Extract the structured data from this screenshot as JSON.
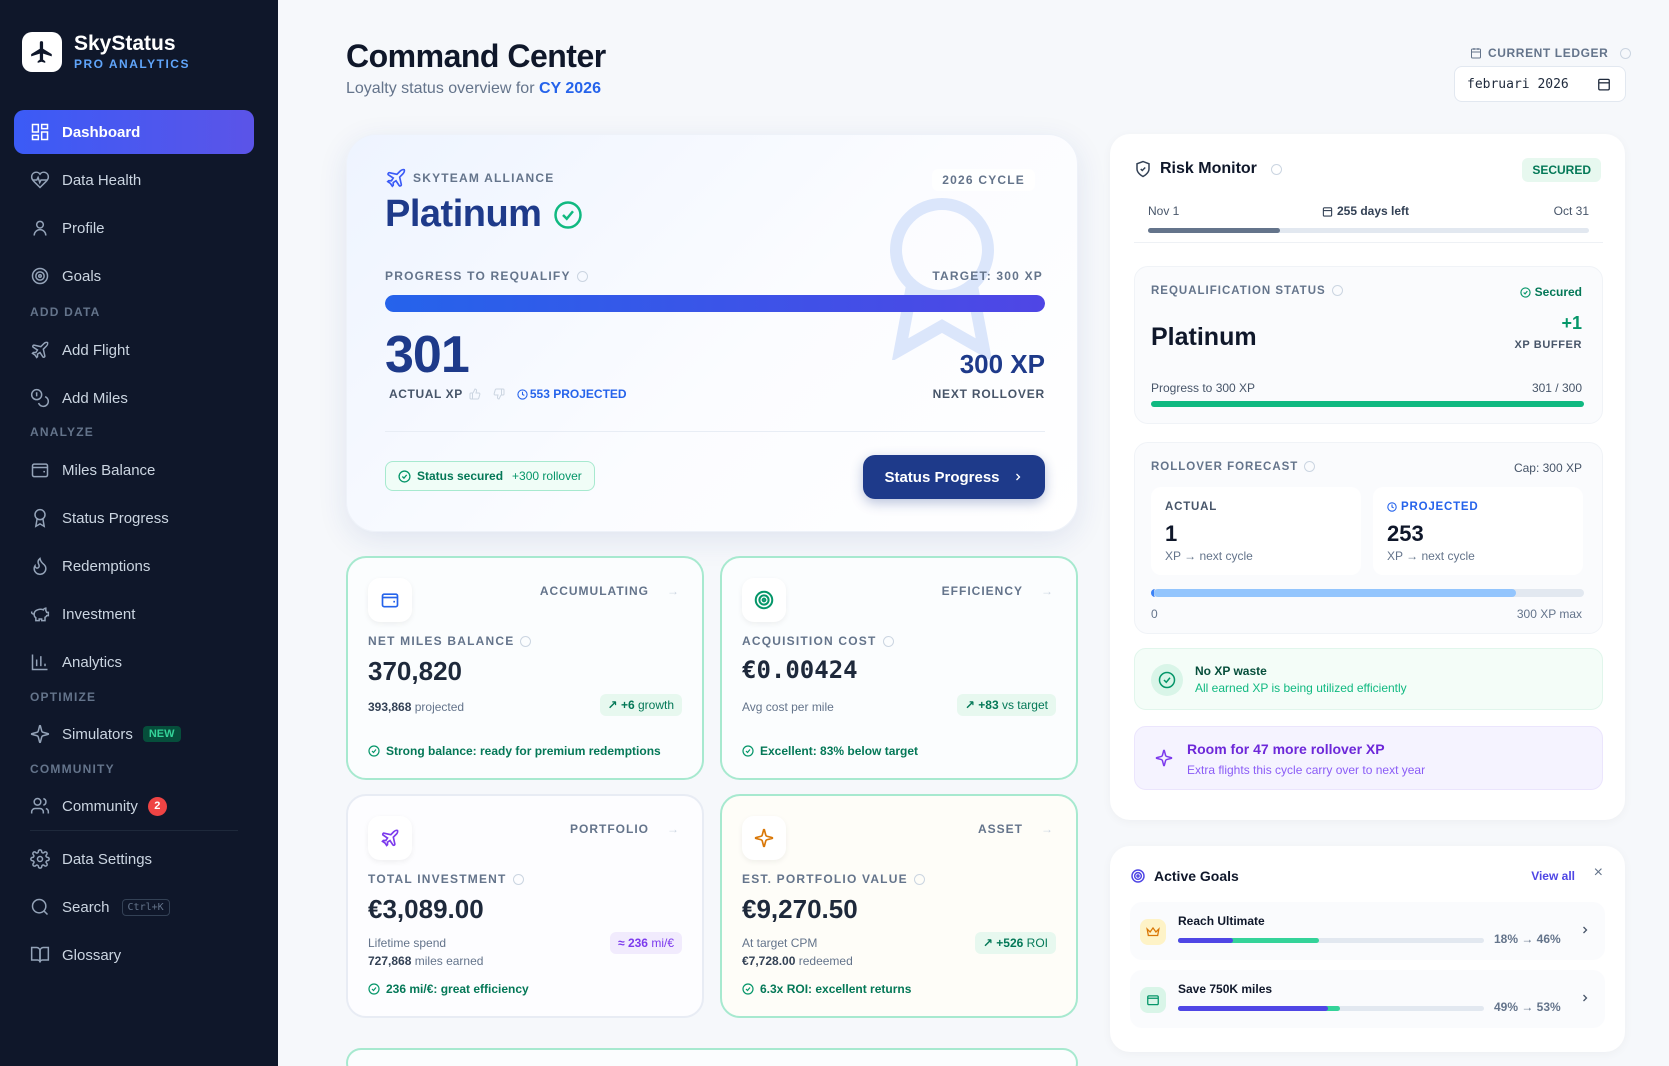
{
  "app": {
    "name": "SkyStatus",
    "subtitle": "PRO ANALYTICS"
  },
  "sidebar": {
    "items": [
      {
        "label": "Dashboard",
        "icon": "grid-icon",
        "active": true
      },
      {
        "label": "Data Health",
        "icon": "heart-pulse-icon"
      },
      {
        "label": "Profile",
        "icon": "user-icon"
      },
      {
        "label": "Goals",
        "icon": "target-icon"
      },
      {
        "label": "Add Flight",
        "icon": "plane-icon"
      },
      {
        "label": "Add Miles",
        "icon": "coins-icon"
      },
      {
        "label": "Miles Balance",
        "icon": "wallet-icon"
      },
      {
        "label": "Status Progress",
        "icon": "award-icon"
      },
      {
        "label": "Redemptions",
        "icon": "flame-icon"
      },
      {
        "label": "Investment",
        "icon": "piggy-bank-icon"
      },
      {
        "label": "Analytics",
        "icon": "bar-chart-icon"
      },
      {
        "label": "Simulators",
        "icon": "sparkles-icon",
        "badge": "NEW"
      },
      {
        "label": "Community",
        "icon": "users-icon",
        "count": "2"
      },
      {
        "label": "Data Settings",
        "icon": "gear-icon"
      },
      {
        "label": "Search",
        "icon": "search-icon",
        "shortcut": "Ctrl+K"
      },
      {
        "label": "Glossary",
        "icon": "book-icon"
      }
    ],
    "sections": [
      "ADD DATA",
      "ANALYZE",
      "OPTIMIZE",
      "COMMUNITY"
    ]
  },
  "header": {
    "title": "Command Center",
    "subtitle_prefix": "Loyalty status overview for",
    "subtitle_year": "CY 2026",
    "ledger_label": "CURRENT LEDGER",
    "ledger_value": "februari 2026"
  },
  "hero": {
    "alliance": "SKYTEAM ALLIANCE",
    "status": "Platinum",
    "cycle": "2026 CYCLE",
    "progress_label": "PROGRESS TO REQUALIFY",
    "target": "TARGET: 300 XP",
    "progress_fraction": 1.0,
    "actual_xp": "301",
    "actual_label": "ACTUAL XP",
    "projected": "553 PROJECTED",
    "rollover_value": "300 XP",
    "rollover_label": "NEXT ROLLOVER",
    "secured_text": "Status secured",
    "secured_extra": "+300 rollover",
    "button": "Status Progress"
  },
  "minis": [
    {
      "tag": "ACCUMULATING",
      "label": "NET MILES BALANCE",
      "value": "370,820",
      "sub_value": "393,868",
      "sub_text": "projected",
      "pill_value": "+6",
      "pill_text": "growth",
      "foot": "Strong balance: ready for premium redemptions",
      "icon": "wallet-icon"
    },
    {
      "tag": "EFFICIENCY",
      "label": "ACQUISITION COST",
      "value": "€0.00424",
      "sub_text": "Avg cost per mile",
      "pill_value": "+83",
      "pill_text": "vs target",
      "foot": "Excellent: 83% below target",
      "icon": "target-icon"
    },
    {
      "tag": "PORTFOLIO",
      "label": "TOTAL INVESTMENT",
      "value": "€3,089.00",
      "sub_line1": "Lifetime spend",
      "sub_value": "727,868",
      "sub_text": "miles earned",
      "pill_value": "236",
      "pill_text": "mi/€",
      "foot": "236 mi/€: great efficiency",
      "icon": "rocket-icon"
    },
    {
      "tag": "ASSET",
      "label": "EST. PORTFOLIO VALUE",
      "value": "€9,270.50",
      "sub_line1": "At target CPM",
      "sub_value": "€7,728.00",
      "sub_text": "redeemed",
      "pill_value": "+526",
      "pill_text": "ROI",
      "foot": "6.3x ROI: excellent returns",
      "icon": "sparkles-icon"
    }
  ],
  "risk": {
    "title": "Risk Monitor",
    "badge": "SECURED",
    "start": "Nov 1",
    "end": "Oct 31",
    "days_left": "255 days left",
    "elapsed_fraction": 0.3,
    "requal_label": "REQUALIFICATION STATUS",
    "requal_badge": "Secured",
    "requal_status": "Platinum",
    "buffer_value": "+1",
    "buffer_label": "XP BUFFER",
    "progress_label": "Progress to 300 XP",
    "progress_value": "301 / 300",
    "progress_fraction": 1.0,
    "rollover_label": "ROLLOVER FORECAST",
    "rollover_cap": "Cap: 300 XP",
    "actual_label": "ACTUAL",
    "actual_value": "1",
    "actual_sub": "XP → next cycle",
    "projected_label": "PROJECTED",
    "projected_value": "253",
    "projected_sub": "XP → next cycle",
    "forecast_fraction": 0.843,
    "scale_min": "0",
    "scale_max": "300 XP max",
    "waste_title": "No XP waste",
    "waste_sub": "All earned XP is being utilized efficiently",
    "room_title": "Room for 47 more rollover XP",
    "room_sub": "Extra flights this cycle carry over to next year"
  },
  "goals": {
    "title": "Active Goals",
    "view_all": "View all",
    "items": [
      {
        "name": "Reach Ultimate",
        "current": 0.18,
        "projected": 0.46,
        "text": "18% → 46%",
        "icon": "crown-icon"
      },
      {
        "name": "Save 750K miles",
        "current": 0.49,
        "projected": 0.53,
        "text": "49% → 53%",
        "icon": "wallet-icon"
      }
    ]
  },
  "colors": {
    "accent": "#3b5bf6",
    "navy": "#1e3a8a",
    "green": "#10b981",
    "purple": "#7c3aed",
    "sidebar": "#0f172a"
  }
}
